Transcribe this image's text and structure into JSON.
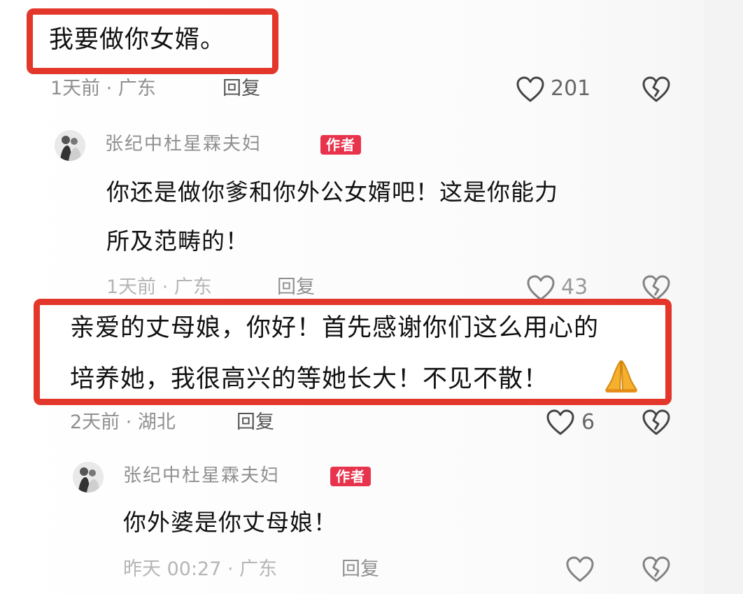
{
  "comments": [
    {
      "text": "我要做你女婿。",
      "time_location": "1天前 · 广东",
      "reply_label": "回复",
      "likes": "201",
      "reply": {
        "author": "张纪中杜星霖夫妇",
        "badge": "作者",
        "text_line1": "你还是做你爹和你外公女婿吧！这是你能力",
        "text_line2": "所及范畴的！",
        "time_location": "1天前 · 广东",
        "reply_label": "回复",
        "likes": "43"
      }
    },
    {
      "text_line1": "亲爱的丈母娘，你好！首先感谢你们这么用心的",
      "text_line2": "培养她，我很高兴的等她长大！不见不散！",
      "time_location": "2天前 · 湖北",
      "reply_label": "回复",
      "likes": "6",
      "reply": {
        "author": "张纪中杜星霖夫妇",
        "badge": "作者",
        "text": "你外婆是你丈母娘！",
        "time_location": "昨天 00:27 · 广东",
        "reply_label": "回复"
      }
    }
  ],
  "icons": {
    "like": "heart-outline-icon",
    "dislike": "broken-heart-icon",
    "emoji": "praying-hands-emoji"
  },
  "colors": {
    "highlight_border": "#e3372b",
    "author_badge": "#e8334d",
    "meta_text": "#8f8f8f"
  }
}
